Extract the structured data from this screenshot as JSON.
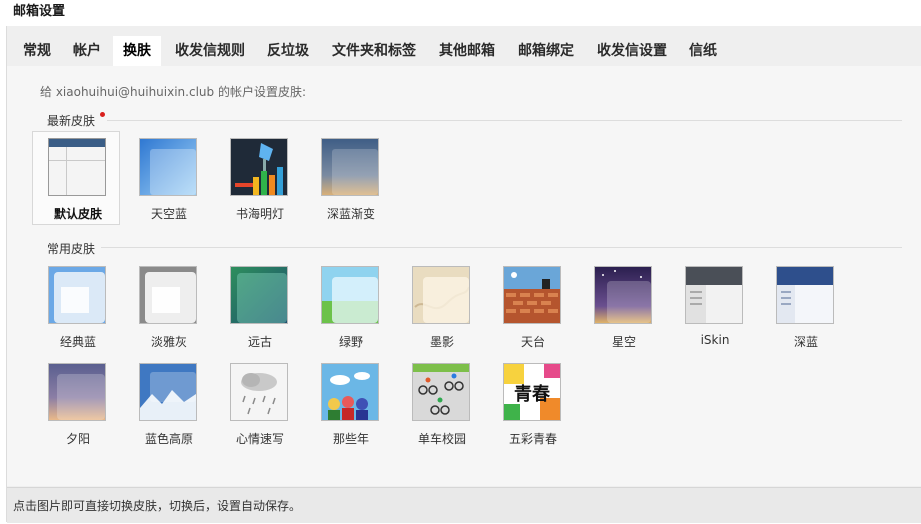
{
  "window": {
    "title": "邮箱设置"
  },
  "tabs": [
    {
      "label": "常规"
    },
    {
      "label": "帐户"
    },
    {
      "label": "换肤",
      "active": true
    },
    {
      "label": "收发信规则"
    },
    {
      "label": "反垃圾"
    },
    {
      "label": "文件夹和标签"
    },
    {
      "label": "其他邮箱"
    },
    {
      "label": "邮箱绑定"
    },
    {
      "label": "收发信设置"
    },
    {
      "label": "信纸"
    }
  ],
  "hint": "给 xiaohuihui@huihuixin.club 的帐户设置皮肤:",
  "sections": {
    "latest": {
      "label": "最新皮肤",
      "badge_color": "#d9201d"
    },
    "common": {
      "label": "常用皮肤"
    }
  },
  "latest_skins": [
    {
      "label": "默认皮肤",
      "icon": "default-skin-thumbnail",
      "selected": true
    },
    {
      "label": "天空蓝",
      "icon": "sky-blue-thumbnail"
    },
    {
      "label": "书海明灯",
      "icon": "book-lamp-thumbnail"
    },
    {
      "label": "深蓝渐变",
      "icon": "deep-blue-gradient-thumbnail"
    }
  ],
  "common_skins": [
    {
      "label": "经典蓝",
      "icon": "classic-blue-thumbnail"
    },
    {
      "label": "淡雅灰",
      "icon": "elegant-gray-thumbnail"
    },
    {
      "label": "远古",
      "icon": "ancient-thumbnail"
    },
    {
      "label": "绿野",
      "icon": "green-field-thumbnail"
    },
    {
      "label": "墨影",
      "icon": "ink-shadow-thumbnail"
    },
    {
      "label": "天台",
      "icon": "rooftop-thumbnail"
    },
    {
      "label": "星空",
      "icon": "starry-sky-thumbnail"
    },
    {
      "label": "iSkin",
      "icon": "iskin-thumbnail"
    },
    {
      "label": "深蓝",
      "icon": "deep-blue-thumbnail"
    },
    {
      "label": "夕阳",
      "icon": "sunset-thumbnail"
    },
    {
      "label": "蓝色高原",
      "icon": "blue-plateau-thumbnail"
    },
    {
      "label": "心情速写",
      "icon": "mood-sketch-thumbnail"
    },
    {
      "label": "那些年",
      "icon": "those-years-thumbnail"
    },
    {
      "label": "单车校园",
      "icon": "bike-campus-thumbnail"
    },
    {
      "label": "五彩青春",
      "icon": "colorful-youth-thumbnail",
      "art_text": "青春"
    }
  ],
  "footer": {
    "text": "点击图片即可直接切换皮肤，切换后，设置自动保存。"
  }
}
